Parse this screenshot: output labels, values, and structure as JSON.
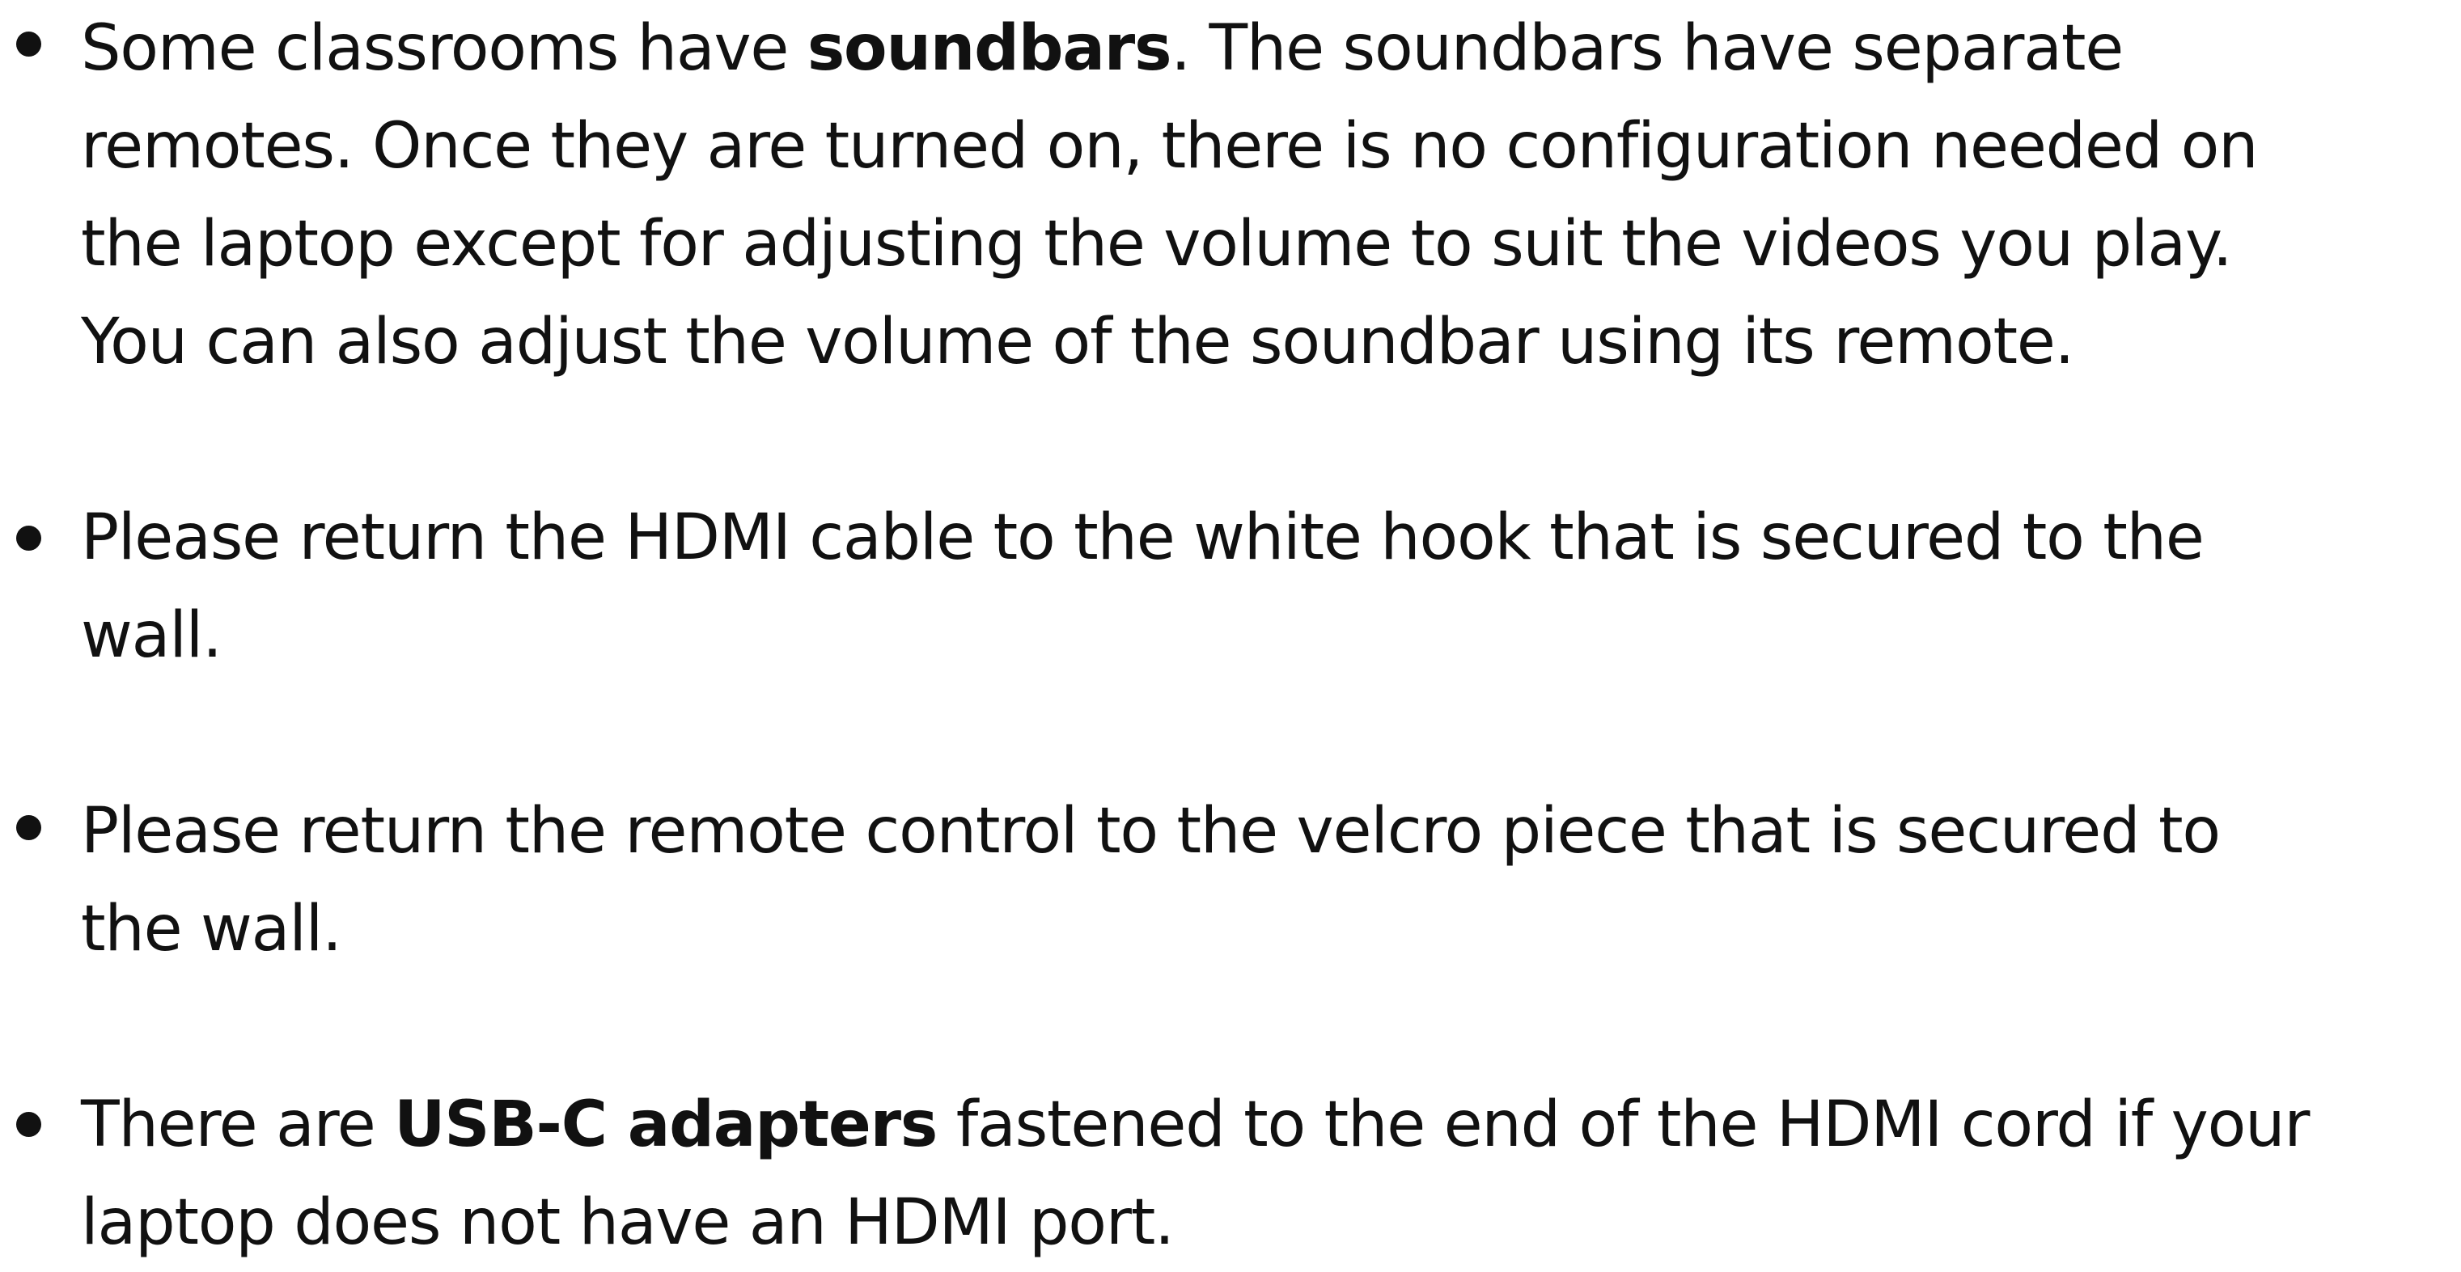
{
  "items": [
    {
      "lines": [
        {
          "before": "Some classrooms have ",
          "bold": "soundbars",
          "after": ". The soundbars have separate"
        },
        "remotes. Once they are turned on, there is no configuration needed on",
        "the laptop except for adjusting the volume to suit the videos you play.",
        "You can also adjust the volume of the soundbar using its remote."
      ]
    },
    {
      "lines": [
        "Please return the HDMI cable to the white hook that is secured to the",
        "wall."
      ]
    },
    {
      "lines": [
        "Please return the remote control to the velcro piece that is secured to",
        "the wall."
      ]
    },
    {
      "lines": [
        {
          "before": "There are ",
          "bold": "USB-C adapters",
          "after": " fastened to the end of the HDMI cord if your"
        },
        "laptop does not have an HDMI port."
      ]
    }
  ]
}
